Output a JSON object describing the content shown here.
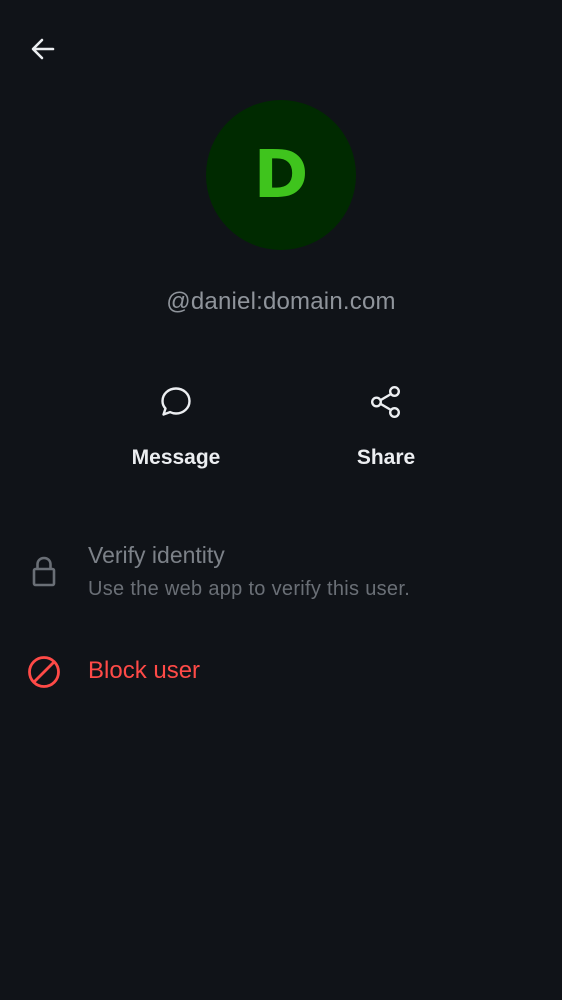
{
  "header": {
    "back_icon": "arrow-left-icon"
  },
  "profile": {
    "avatar_letter": "D",
    "avatar_bg": "#002a00",
    "avatar_fg": "#3fc41d",
    "user_id": "@daniel:domain.com"
  },
  "actions": [
    {
      "icon": "chat-bubble-icon",
      "label": "Message"
    },
    {
      "icon": "share-icon",
      "label": "Share"
    }
  ],
  "verify": {
    "icon": "lock-icon",
    "title": "Verify identity",
    "subtitle": "Use the web app to verify this user."
  },
  "block": {
    "icon": "block-icon",
    "label": "Block user",
    "color": "#ff4a47"
  }
}
